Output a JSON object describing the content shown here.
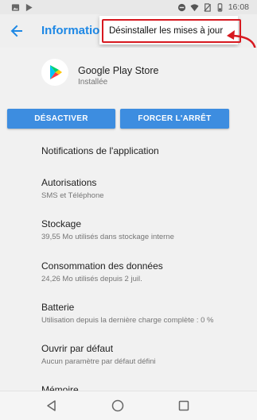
{
  "status_bar": {
    "time": "16:08",
    "left_icons": [
      "image-icon",
      "play-icon"
    ],
    "right_icons": [
      "minus-circle-icon",
      "wifi-icon",
      "no-sim-icon",
      "battery-icon"
    ]
  },
  "app_bar": {
    "title": "Information",
    "back_icon": "arrow-left-icon"
  },
  "overflow_menu": {
    "item": "Désinstaller les mises à jour",
    "highlight_color": "#d71920"
  },
  "app": {
    "name": "Google Play Store",
    "state": "Installée",
    "icon": "play-store-icon"
  },
  "buttons": {
    "disable": "DÉSACTIVER",
    "force_stop": "FORCER L'ARRÊT",
    "color": "#3d8de0"
  },
  "settings": [
    {
      "title": "Notifications de l'application",
      "subtitle": ""
    },
    {
      "title": "Autorisations",
      "subtitle": "SMS et Téléphone"
    },
    {
      "title": "Stockage",
      "subtitle": "39,55 Mo utilisés dans stockage interne"
    },
    {
      "title": "Consommation des données",
      "subtitle": "24,26 Mo utilisés depuis 2 juil."
    },
    {
      "title": "Batterie",
      "subtitle": "Utilisation depuis la dernière charge complète : 0 %"
    },
    {
      "title": "Ouvrir par défaut",
      "subtitle": "Aucun paramètre par défaut défini"
    },
    {
      "title": "Mémoire",
      "subtitle": ""
    }
  ],
  "nav_bar": {
    "icons": [
      "back-triangle-icon",
      "home-circle-icon",
      "recents-square-icon"
    ]
  }
}
